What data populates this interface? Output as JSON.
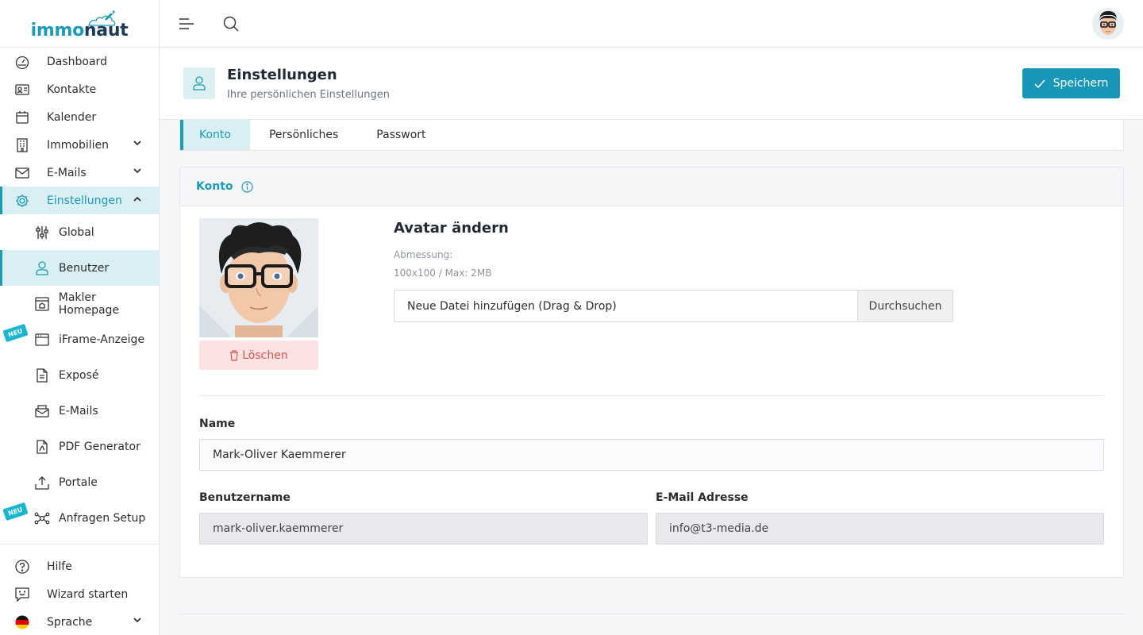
{
  "brand": {
    "part1": "immo",
    "part2": "naut"
  },
  "sidebar": {
    "items": [
      {
        "label": "Dashboard"
      },
      {
        "label": "Kontakte"
      },
      {
        "label": "Kalender"
      },
      {
        "label": "Immobilien"
      },
      {
        "label": "E-Mails"
      },
      {
        "label": "Einstellungen"
      }
    ],
    "subitems": [
      {
        "label": "Global"
      },
      {
        "label": "Benutzer"
      },
      {
        "label": "Makler Homepage"
      },
      {
        "label": "iFrame-Anzeige",
        "badge": "NEU"
      },
      {
        "label": "Exposé"
      },
      {
        "label": "E-Mails"
      },
      {
        "label": "PDF Generator"
      },
      {
        "label": "Portale"
      },
      {
        "label": "Anfragen Setup",
        "badge": "NEU"
      }
    ],
    "bottom": [
      {
        "label": "Hilfe"
      },
      {
        "label": "Wizard starten"
      },
      {
        "label": "Sprache"
      }
    ]
  },
  "header": {
    "title": "Einstellungen",
    "subtitle": "Ihre persönlichen Einstellungen",
    "save_label": "Speichern"
  },
  "tabs": [
    {
      "label": "Konto"
    },
    {
      "label": "Persönliches"
    },
    {
      "label": "Passwort"
    }
  ],
  "card": {
    "title": "Konto",
    "delete_label": "Löschen",
    "avatar_title": "Avatar ändern",
    "dim_label": "Abmessung:",
    "dim_value": "100x100 / Max: 2MB",
    "file_placeholder": "Neue Datei hinzufügen (Drag & Drop)",
    "browse_label": "Durchsuchen",
    "name_label": "Name",
    "name_value": "Mark-Oliver Kaemmerer",
    "username_label": "Benutzername",
    "username_value": "mark-oliver.kaemmerer",
    "email_label": "E-Mail Adresse",
    "email_value": "info@t3-media.de"
  },
  "colors": {
    "accent": "#1a9bb8",
    "primary_button": "#1796b7",
    "danger_bg": "#fbe3e3",
    "danger_text": "#d9534f"
  }
}
